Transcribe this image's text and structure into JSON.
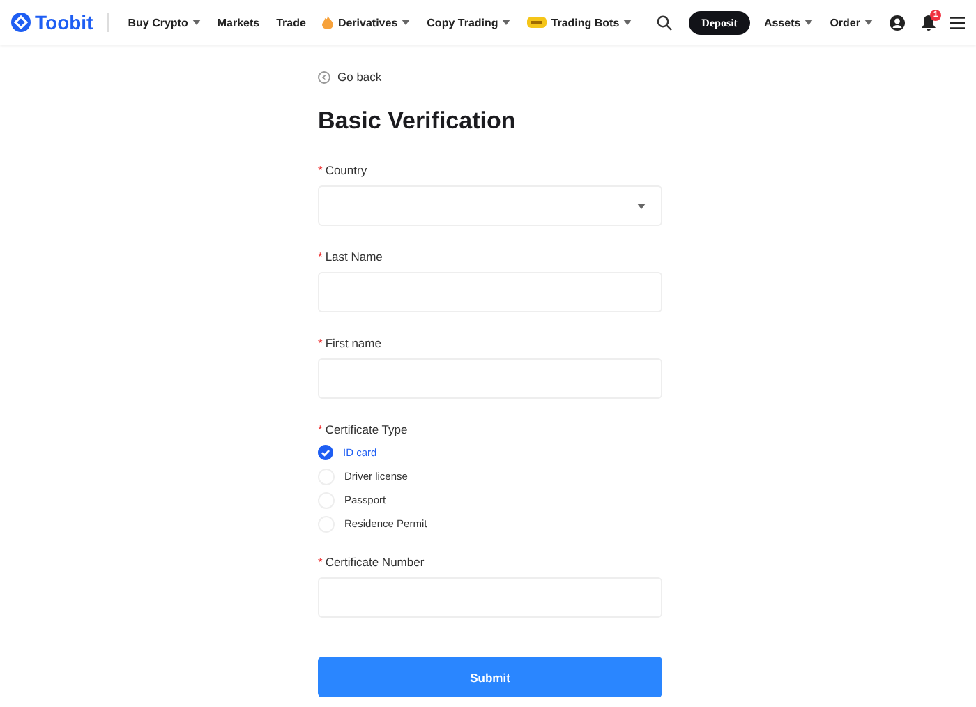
{
  "header": {
    "logo": "Toobit",
    "nav": [
      {
        "label": "Buy Crypto",
        "kind": "dropdown"
      },
      {
        "label": "Markets",
        "kind": "link"
      },
      {
        "label": "Trade",
        "kind": "link"
      },
      {
        "label": "Derivatives",
        "kind": "hot-dropdown"
      },
      {
        "label": "Copy Trading",
        "kind": "dropdown"
      },
      {
        "label": "Trading Bots",
        "kind": "bot-dropdown"
      }
    ],
    "deposit": "Deposit",
    "menus": [
      {
        "label": "Assets"
      },
      {
        "label": "Order"
      }
    ],
    "notification_count": "1"
  },
  "go_back": "Go back",
  "title": "Basic Verification",
  "fields": [
    {
      "label": "Country",
      "kind": "select",
      "required_marker": "*"
    },
    {
      "label": "Last Name",
      "kind": "text",
      "required_marker": "*"
    },
    {
      "label": "First name",
      "kind": "text",
      "required_marker": "*"
    },
    {
      "label": "Certificate Type",
      "kind": "radio",
      "required_marker": "*",
      "options": [
        {
          "label": "ID card",
          "selected": true
        },
        {
          "label": "Driver license",
          "selected": false
        },
        {
          "label": "Passport",
          "selected": false
        },
        {
          "label": "Residence Permit",
          "selected": false
        }
      ]
    },
    {
      "label": "Certificate Number",
      "kind": "text",
      "required_marker": "*"
    }
  ],
  "submit": "Submit"
}
